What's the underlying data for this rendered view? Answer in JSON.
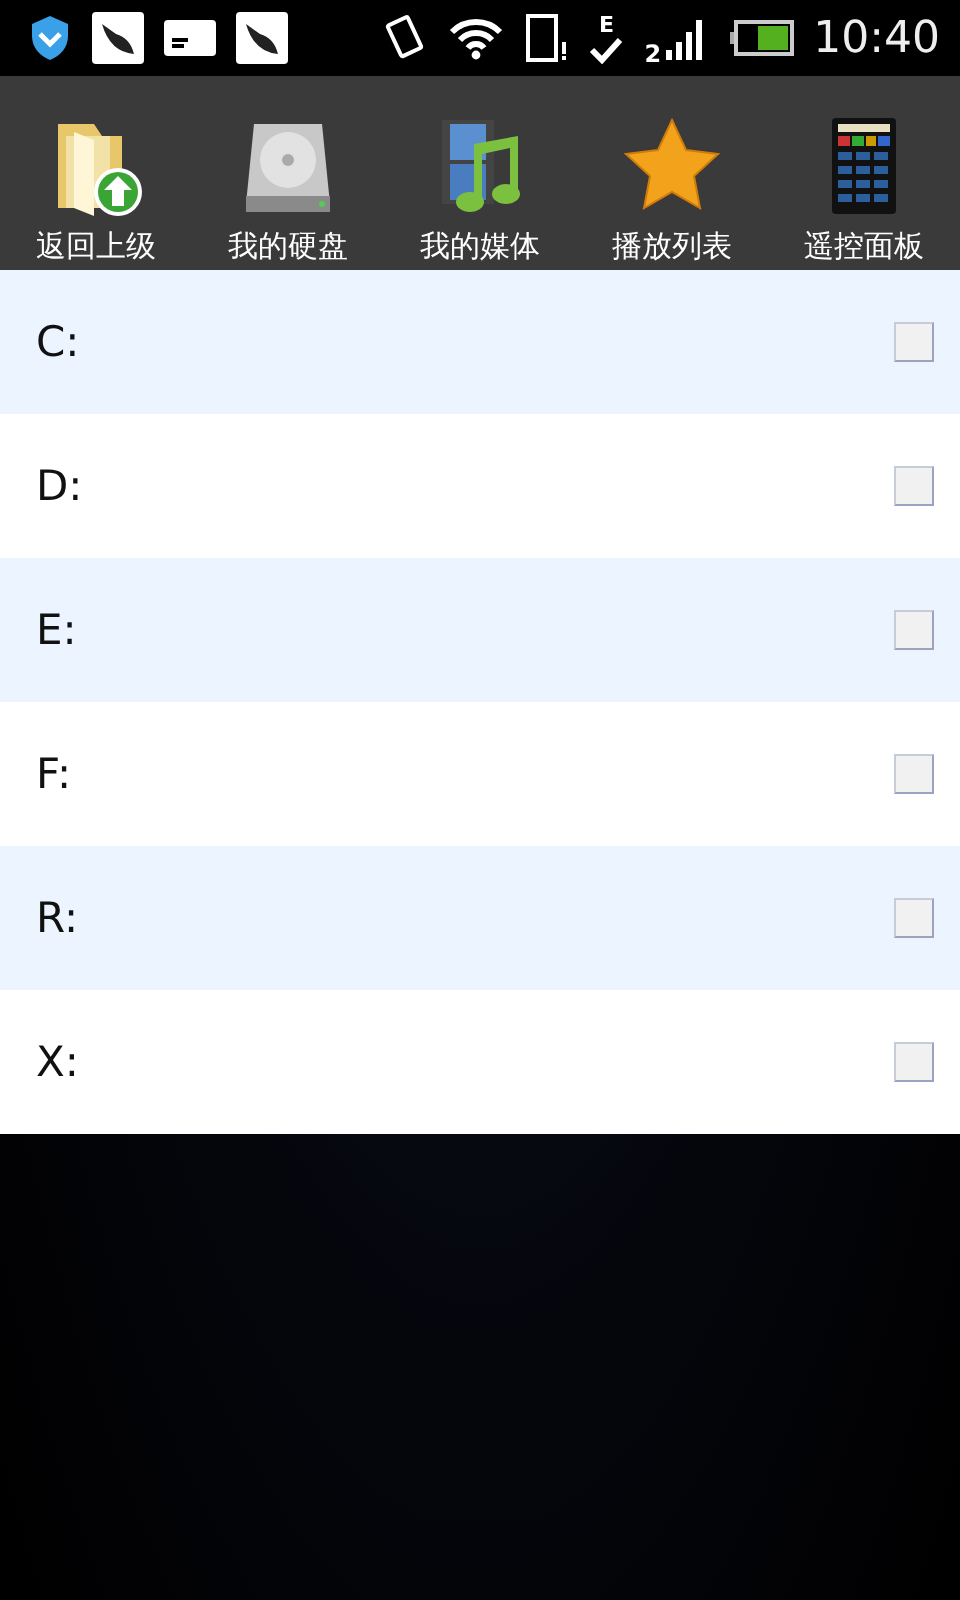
{
  "status_bar": {
    "network_type": "E",
    "sim_slot": "2",
    "time": "10:40"
  },
  "toolbar": [
    {
      "kind": "up",
      "label": "返回上级"
    },
    {
      "kind": "disk",
      "label": "我的硬盘"
    },
    {
      "kind": "media",
      "label": "我的媒体"
    },
    {
      "kind": "playlist",
      "label": "播放列表"
    },
    {
      "kind": "remote",
      "label": "遥控面板"
    }
  ],
  "drives": [
    {
      "label": "C:",
      "checked": false
    },
    {
      "label": "D:",
      "checked": false
    },
    {
      "label": "E:",
      "checked": false
    },
    {
      "label": "F:",
      "checked": false
    },
    {
      "label": "R:",
      "checked": false
    },
    {
      "label": "X:",
      "checked": false
    }
  ]
}
